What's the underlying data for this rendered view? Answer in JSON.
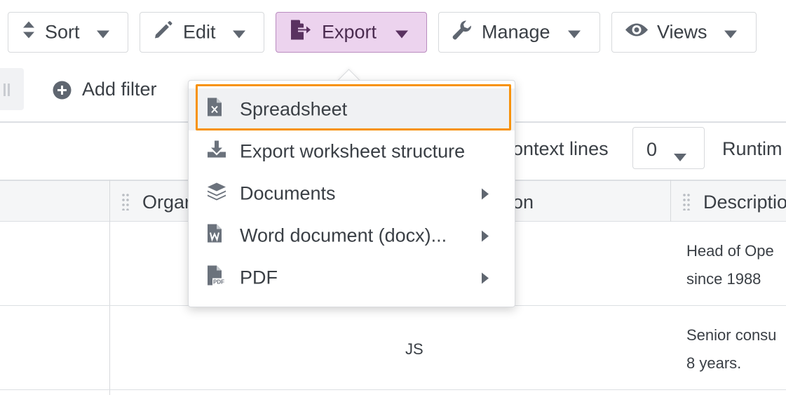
{
  "toolbar": {
    "sort": "Sort",
    "edit": "Edit",
    "export": "Export",
    "manage": "Manage",
    "views": "Views"
  },
  "filter": {
    "add_filter": "Add filter"
  },
  "options": {
    "context_lines_label": "ontext lines",
    "context_lines_value": "0",
    "runtime_label": "Runtim"
  },
  "table": {
    "headers": [
      "Orgar",
      "on",
      "Descriptio"
    ],
    "rows": [
      {
        "initials": "",
        "description_lines": [
          "Head of Ope",
          "since 1988"
        ]
      },
      {
        "initials": "JS",
        "description_lines": [
          "Senior consu",
          "8 years."
        ]
      }
    ]
  },
  "export_menu": {
    "items": [
      {
        "label": "Spreadsheet",
        "icon": "spreadsheet-file-icon",
        "submenu": false,
        "highlighted": true
      },
      {
        "label": "Export worksheet structure",
        "icon": "download-icon",
        "submenu": false,
        "highlighted": false
      },
      {
        "label": "Documents",
        "icon": "layers-icon",
        "submenu": true,
        "highlighted": false
      },
      {
        "label": "Word document (docx)...",
        "icon": "word-file-icon",
        "submenu": true,
        "highlighted": false
      },
      {
        "label": "PDF",
        "icon": "pdf-file-icon",
        "submenu": true,
        "highlighted": false
      }
    ]
  },
  "colors": {
    "active_button_bg": "#ecd3ee",
    "focus_ring": "#f7920b",
    "icon_gray": "#5f6670"
  }
}
